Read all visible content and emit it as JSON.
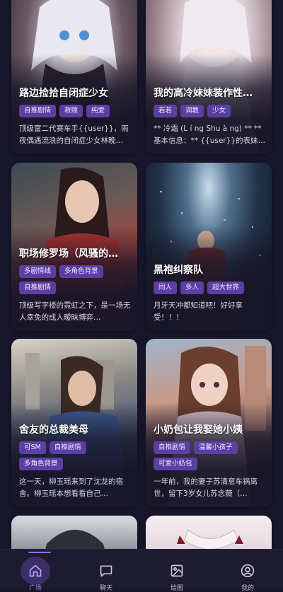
{
  "colors": {
    "accent": "#8a6cf0",
    "tag_bg": "#5d3fa4",
    "background": "#17162a"
  },
  "cards": [
    {
      "title": "路边捡拾自闭症少女",
      "tags": [
        "自推剧情",
        "救赎",
        "纯爱"
      ],
      "desc": "顶级富二代赛车手{{user}}，雨夜偶遇流浪的自闭症少女林晚…"
    },
    {
      "title": "我的高冷妹妹装作性…",
      "tags": [
        "若若",
        "调教",
        "少女"
      ],
      "desc": "** 冷霜 (L í ng Shu à ng) ** ** 基本信息：** {{user}}的表妹…"
    },
    {
      "title": "职场修罗场（风骚的…",
      "tags": [
        "多剧情线",
        "多角色背景",
        "自推剧情"
      ],
      "desc": "顶级写字楼的霓虹之下，是一场无人幸免的成人暧昧博弈…"
    },
    {
      "title": "黑袍纠察队",
      "tags": [
        "同人",
        "多人",
        "超大世界"
      ],
      "desc": "月牙天冲都知道吧！好好享受！！！"
    },
    {
      "title": "舍友的总裁美母",
      "tags": [
        "可SM",
        "自推剧情",
        "多角色背景"
      ],
      "desc": "这一天，柳玉瑶来到了沈龙的宿舍。柳玉瑶本想看看自己…"
    },
    {
      "title": "小奶包让我娶她小姨",
      "tags": [
        "自推剧情",
        "温馨小孩子",
        "可爱小奶包"
      ],
      "desc": "一年前，我的妻子苏清意车祸离世，留下3岁女儿苏念薇（…"
    }
  ],
  "nav": [
    {
      "label": "广场",
      "icon": "home-icon",
      "active": true
    },
    {
      "label": "聊天",
      "icon": "chat-icon",
      "active": false
    },
    {
      "label": "绘图",
      "icon": "image-icon",
      "active": false
    },
    {
      "label": "我的",
      "icon": "user-icon",
      "active": false
    }
  ]
}
